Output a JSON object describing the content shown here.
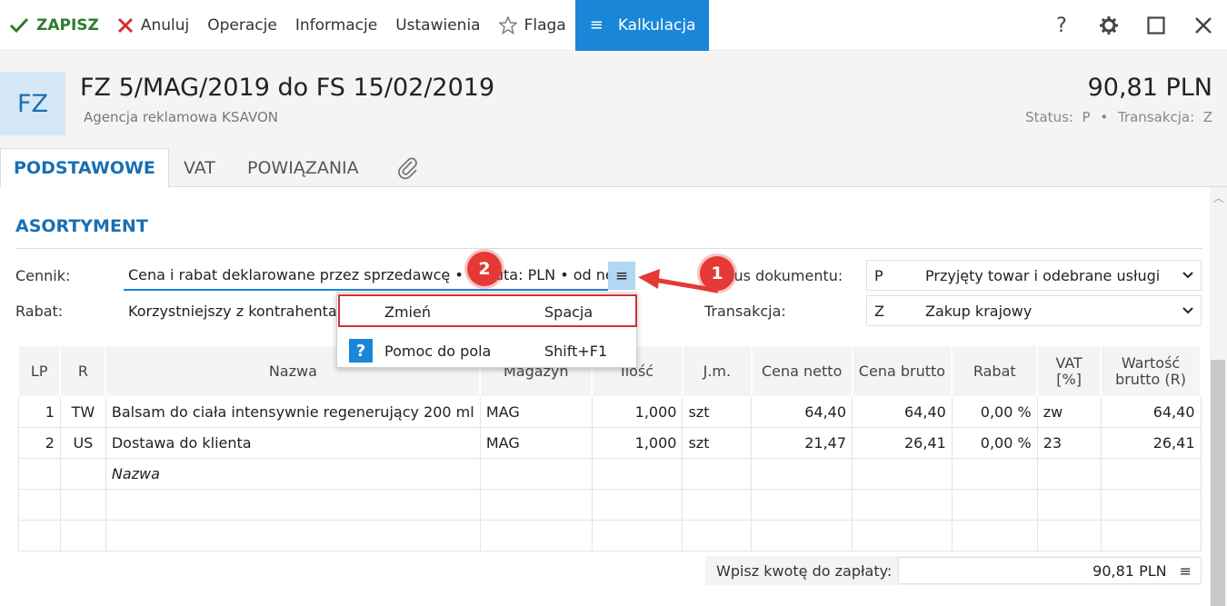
{
  "toolbar": {
    "save": "ZAPISZ",
    "cancel": "Anuluj",
    "operations": "Operacje",
    "information": "Informacje",
    "settings": "Ustawienia",
    "flag": "Flaga",
    "calc": "Kalkulacja",
    "help": "?"
  },
  "header": {
    "badge": "FZ",
    "title": "FZ 5/MAG/2019 do FS 15/02/2019",
    "contractor": "Agencja reklamowa KSAVON",
    "amount": "90,81 PLN",
    "status_label": "Status:",
    "status_value": "P",
    "trans_label": "Transakcja:",
    "trans_value": "Z"
  },
  "tabs": [
    "PODSTAWOWE",
    "VAT",
    "POWIĄZANIA"
  ],
  "section": {
    "title": "ASORTYMENT"
  },
  "form": {
    "cennik_label": "Cennik:",
    "cennik_value": "Cena i rabat deklarowane przez sprzedawcę • Waluta: PLN • od ne",
    "rabat_label": "Rabat:",
    "rabat_value": "Korzystniejszy z kontrahenta/",
    "status_label": "Status dokumentu:",
    "status_code": "P",
    "status_text": "Przyjęty towar i odebrane usługi",
    "trans_label": "Transakcja:",
    "trans_code": "Z",
    "trans_text": "Zakup krajowy"
  },
  "context_menu": {
    "items": [
      {
        "label": "Zmień",
        "shortcut": "Spacja"
      },
      {
        "label": "Pomoc do pola",
        "shortcut": "Shift+F1"
      }
    ]
  },
  "grid": {
    "headers": [
      "LP",
      "R",
      "Nazwa",
      "Magazyn",
      "Ilość",
      "J.m.",
      "Cena netto",
      "Cena brutto",
      "Rabat",
      "VAT [%]",
      "Wartość brutto (R)"
    ],
    "header_vat_top": "VAT",
    "header_vat_bottom": "[%]",
    "header_val_top": "Wartość",
    "header_val_bottom": "brutto (R)",
    "rows": [
      {
        "lp": "1",
        "r": "TW",
        "name": "Balsam do ciała intensywnie regenerujący 200 ml",
        "mag": "MAG",
        "qty": "1,000",
        "jm": "szt",
        "netto": "64,40",
        "brutto": "64,40",
        "rabat": "0,00 %",
        "vat": "zw",
        "value": "64,40"
      },
      {
        "lp": "2",
        "r": "US",
        "name": "Dostawa do klienta",
        "mag": "MAG",
        "qty": "1,000",
        "jm": "szt",
        "netto": "21,47",
        "brutto": "26,41",
        "rabat": "0,00 %",
        "vat": "23",
        "value": "26,41"
      }
    ],
    "name_placeholder": "Nazwa"
  },
  "footer": {
    "pay_label": "Wpisz kwotę do zapłaty:",
    "pay_value": "90,81 PLN"
  },
  "markers": {
    "one": "1",
    "two": "2"
  },
  "colors": {
    "accent": "#1a86d8",
    "save": "#2e7d32",
    "cancel": "#d32f2f",
    "marker": "#e53935"
  }
}
